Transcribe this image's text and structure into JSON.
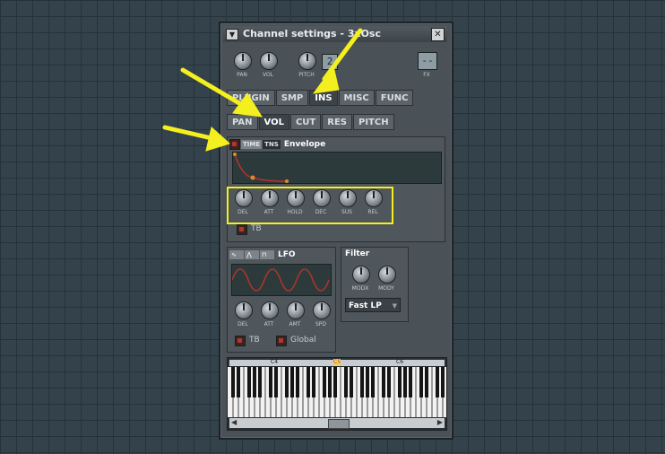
{
  "window": {
    "title": "Channel settings - 3xOsc",
    "menu_icon": "triangle-down",
    "close_icon": "x"
  },
  "top_knobs": [
    {
      "label": "PAN"
    },
    {
      "label": "VOL"
    },
    {
      "label": "PITCH"
    }
  ],
  "lcd_value": "2",
  "fx": {
    "lcd": "--",
    "label": "FX"
  },
  "main_tabs": [
    "PLUGIN",
    "SMP",
    "INS",
    "MISC",
    "FUNC"
  ],
  "main_tabs_active": "INS",
  "sub_tabs": [
    "PAN",
    "VOL",
    "CUT",
    "RES",
    "PITCH"
  ],
  "sub_tabs_active": "VOL",
  "envelope": {
    "time_label": "TIME",
    "tns_label": "TNS",
    "title": "Envelope",
    "knobs": [
      "DEL",
      "ATT",
      "HOLD",
      "DEC",
      "SUS",
      "REL"
    ],
    "tb_label": "TB"
  },
  "lfo": {
    "title": "LFO",
    "knobs": [
      "DEL",
      "ATT",
      "AMT",
      "SPD"
    ],
    "tb_label": "TB",
    "global_label": "Global"
  },
  "filter": {
    "title": "Filter",
    "knobs": [
      "MODX",
      "MODY"
    ],
    "type": "Fast LP"
  },
  "keyboard": {
    "markers": [
      "C4",
      "C5",
      "C6"
    ]
  },
  "colors": {
    "accent": "#f4ef1e",
    "envelope_curve": "#b2342b",
    "background": "#34434b"
  }
}
